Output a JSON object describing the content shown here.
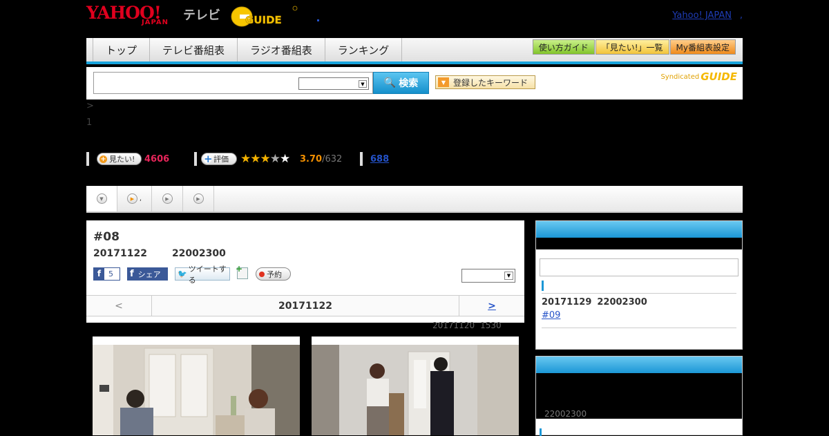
{
  "header": {
    "logo_yahoo": "YAHOO!",
    "logo_japan": "JAPAN",
    "logo_tv": "テレビ",
    "logo_gguide": "G GUIDE",
    "top_link": "Yahoo! JAPAN",
    "top_link_dot": ","
  },
  "nav": {
    "items": [
      "トップ",
      "テレビ番組表",
      "ラジオ番組表",
      "ランキング"
    ],
    "right": [
      "使い方ガイド",
      "「見たい!」一覧",
      "My番組表設定"
    ]
  },
  "search": {
    "button_label": "検索",
    "keyword_button": "登録したキーワード",
    "syndicated": "Syndicated",
    "syndicated_logo": "GUIDE"
  },
  "breadcrumb": {
    "line1": ">",
    "line2": "1"
  },
  "stats": {
    "want_label": "見たい!",
    "want_count": "4606",
    "rate_label": "評価",
    "rating_value": "3.70",
    "rating_count": "/632",
    "rating_fraction": 0.74,
    "review_count": "688"
  },
  "tabs": {
    "tab2_suffix": ","
  },
  "episode": {
    "title": "#08",
    "date": "20171122",
    "time": "22002300",
    "fb_like_count": "5",
    "fb_share": "シェア",
    "tweet": "ツイートする",
    "reserve": "予約",
    "prev": "<",
    "current_date": "20171122",
    "next": ">",
    "updated_date": "20171120",
    "updated_time": "1530"
  },
  "side": {
    "next_date": "20171129",
    "next_time": "22002300",
    "next_ep": "#09",
    "box2_time": "22002300"
  },
  "colors": {
    "accent_blue": "#17a3dc",
    "yahoo_red": "#e0001e",
    "want_pink": "#e8255a",
    "rating_orange": "#f28f00"
  }
}
